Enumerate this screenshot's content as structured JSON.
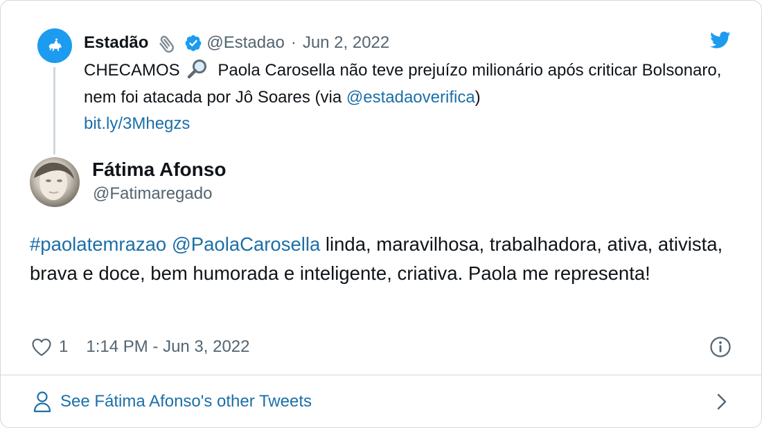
{
  "parent_tweet": {
    "author_name": "Estadão",
    "author_handle": "@Estadao",
    "separator": "·",
    "date": "Jun 2, 2022",
    "text_start": "CHECAMOS",
    "text_middle": " Paola Carosella não teve prejuízo milionário após criticar Bolsonaro, nem foi atacada por Jô Soares (via ",
    "mention": "@estadaoverifica",
    "text_end": ")",
    "short_link": "bit.ly/3Mhegzs"
  },
  "reply_tweet": {
    "author_name": "Fátima Afonso",
    "author_handle": "@Fatimaregado",
    "hashtag": "#paolatemrazao",
    "mention": "@PaolaCarosella",
    "text": " linda, maravilhosa, trabalhadora, ativa, ativista, brava e doce, bem humorada e inteligente, criativa. Paola me representa!",
    "like_count": "1",
    "timestamp": "1:14 PM - Jun 3, 2022"
  },
  "footer": {
    "link_text": "See Fátima Afonso's other Tweets"
  },
  "colors": {
    "link": "#1b6fa8",
    "twitter_blue": "#1d9bf0",
    "secondary_text": "#536471",
    "border": "#cfd9de"
  },
  "icons": [
    "twitter-bird-icon",
    "paperclip-icon",
    "verified-badge-icon",
    "magnifying-glass-icon",
    "heart-icon",
    "info-icon",
    "person-icon",
    "chevron-right-icon"
  ]
}
